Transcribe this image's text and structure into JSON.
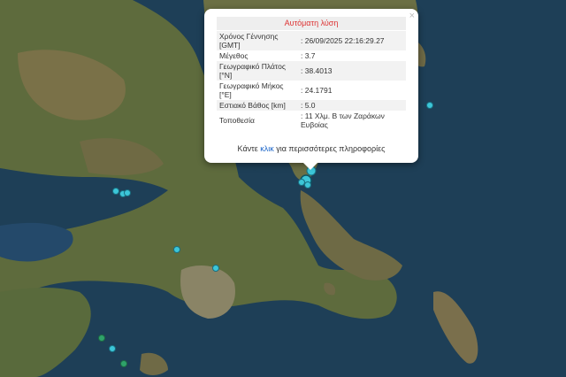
{
  "popup": {
    "title": "Αυτόματη λύση",
    "close_glyph": "×",
    "rows": [
      {
        "label": "Χρόνος Γέννησης [GMT]",
        "value": ": 26/09/2025 22:16:29.27"
      },
      {
        "label": "Μέγεθος",
        "value": ": 3.7"
      },
      {
        "label": "Γεωγραφικό Πλάτος [°N]",
        "value": ": 38.4013"
      },
      {
        "label": "Γεωγραφικό Μήκος [°E]",
        "value": ": 24.1791"
      },
      {
        "label": "Εστιακό Βάθος [km]",
        "value": ": 5.0"
      },
      {
        "label": "Τοποθεσία",
        "value": ": 11 Χλμ. Β των Ζαράκων Ευβοίας"
      }
    ],
    "footer_before": "Κάντε ",
    "footer_link": "κλικ",
    "footer_after": " για περισσότερες πληροφορίες"
  },
  "colors": {
    "sea": "#1e3f57",
    "land": "#5c6a3c",
    "marker_cyan": "#3cc6d8",
    "marker_green": "#2fa36a",
    "title_red": "#d33333"
  }
}
